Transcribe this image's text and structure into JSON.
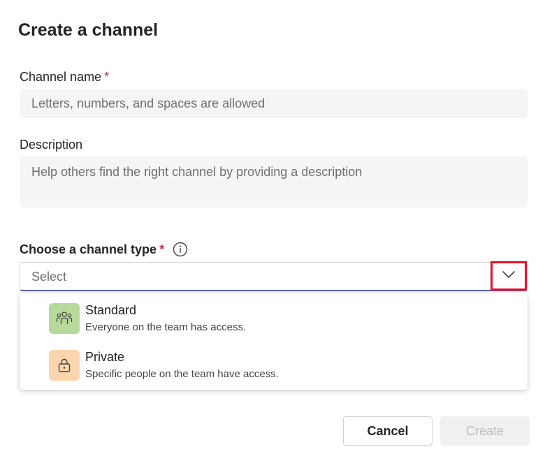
{
  "dialog": {
    "title": "Create a channel"
  },
  "channel_name": {
    "label": "Channel name",
    "required_mark": "*",
    "placeholder": "Letters, numbers, and spaces are allowed"
  },
  "description": {
    "label": "Description",
    "placeholder": "Help others find the right channel by providing a description"
  },
  "channel_type": {
    "label": "Choose a channel type",
    "required_mark": "*",
    "info_icon": "info-icon",
    "select_value": "Select",
    "chevron_icon": "chevron-down-icon",
    "options": [
      {
        "title": "Standard",
        "subtitle": "Everyone on the team has access.",
        "icon": "people-icon",
        "icon_bg": "#b7d99b"
      },
      {
        "title": "Private",
        "subtitle": "Specific people on the team have access.",
        "icon": "lock-icon",
        "icon_bg": "#fbd5ad"
      }
    ]
  },
  "footer": {
    "cancel_label": "Cancel",
    "create_label": "Create"
  },
  "colors": {
    "accent": "#5b5fc7",
    "required": "#c4314b",
    "highlight": "#e81123"
  }
}
